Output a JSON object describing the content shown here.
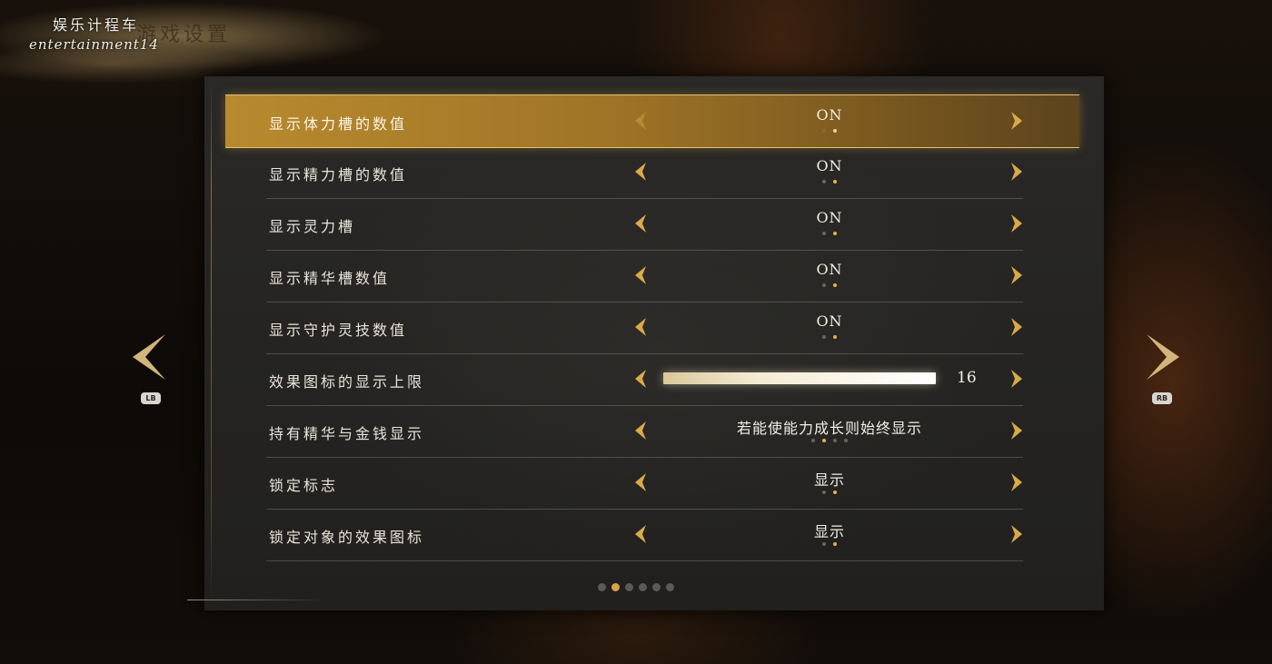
{
  "header": {
    "page_title": "游戏设置",
    "watermark_cn": "娱乐计程车",
    "watermark_en": "entertainment14"
  },
  "settings": [
    {
      "label": "显示体力槽的数值",
      "value": "ON",
      "selected": true,
      "dot_count": 2,
      "active_dot": 2
    },
    {
      "label": "显示精力槽的数值",
      "value": "ON",
      "selected": false,
      "dot_count": 2,
      "active_dot": 2
    },
    {
      "label": "显示灵力槽",
      "value": "ON",
      "selected": false,
      "dot_count": 2,
      "active_dot": 2
    },
    {
      "label": "显示精华槽数值",
      "value": "ON",
      "selected": false,
      "dot_count": 2,
      "active_dot": 2
    },
    {
      "label": "显示守护灵技数值",
      "value": "ON",
      "selected": false,
      "dot_count": 2,
      "active_dot": 2
    },
    {
      "label": "效果图标的显示上限",
      "value": "16",
      "type": "slider",
      "level": 1.0
    },
    {
      "label": "持有精华与金钱显示",
      "value": "若能使能力成长则始终显示",
      "selected": false,
      "dot_count": 4,
      "active_dot": 2
    },
    {
      "label": "锁定标志",
      "value": "显示",
      "selected": false,
      "dot_count": 2,
      "active_dot": 2
    },
    {
      "label": "锁定对象的效果图标",
      "value": "显示",
      "selected": false,
      "dot_count": 2,
      "active_dot": 2
    }
  ],
  "pagination": {
    "total_pages": 6,
    "current_page": 2
  },
  "nav": {
    "prev_button_label": "LB",
    "next_button_label": "RB"
  },
  "colors": {
    "accent_gold": "#d6a446",
    "selected_row": "#b88a2f",
    "panel": "#252422",
    "text": "#e9e4d8"
  },
  "icons": {
    "row_left": "chevron-left-icon",
    "row_right": "chevron-right-icon",
    "page_prev": "large-chevron-left-icon",
    "page_next": "large-chevron-right-icon"
  }
}
